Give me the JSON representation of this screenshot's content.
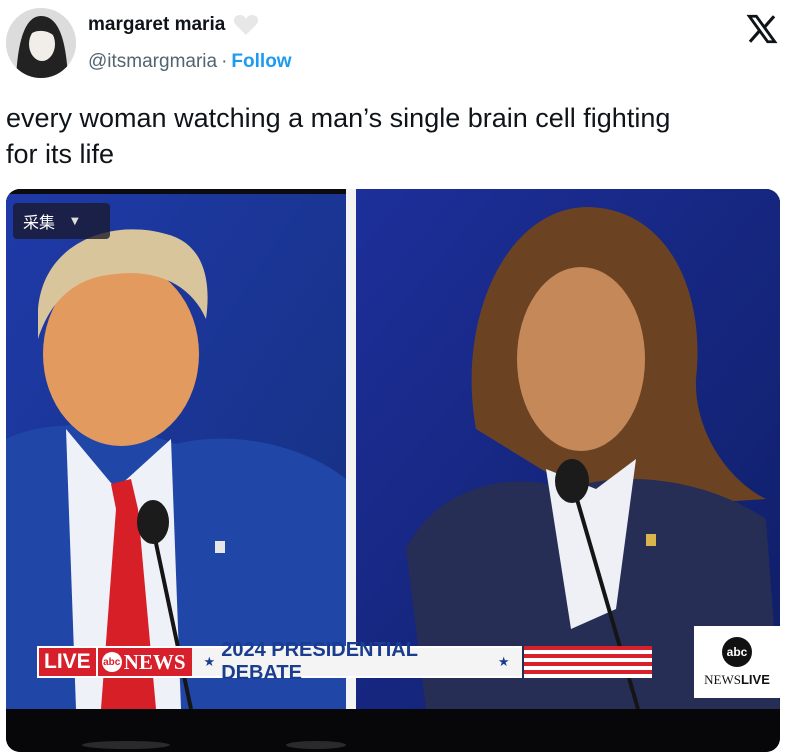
{
  "author": {
    "display_name": "margaret maria",
    "handle": "@itsmargmaria",
    "separator": "·",
    "follow_label": "Follow"
  },
  "tweet": {
    "text": "every woman watching a man’s single brain cell fighting\nfor its life"
  },
  "media": {
    "player_chip_label": "采集",
    "live_label": "LIVE",
    "network_label": "NEWS",
    "network_badge": "abc",
    "banner_text": "2024 PRESIDENTIAL DEBATE",
    "banner_star": "★",
    "corner_logo_badge": "abc",
    "corner_logo_text_1": "NEWS",
    "corner_logo_text_2": "LIVE"
  },
  "colors": {
    "accent_blue": "#1d9bf0",
    "abc_red": "#d8202c",
    "banner_blue": "#1a3d8f"
  },
  "icons": [
    "verified-heart-icon",
    "x-logo-icon",
    "chevron-down-icon"
  ]
}
